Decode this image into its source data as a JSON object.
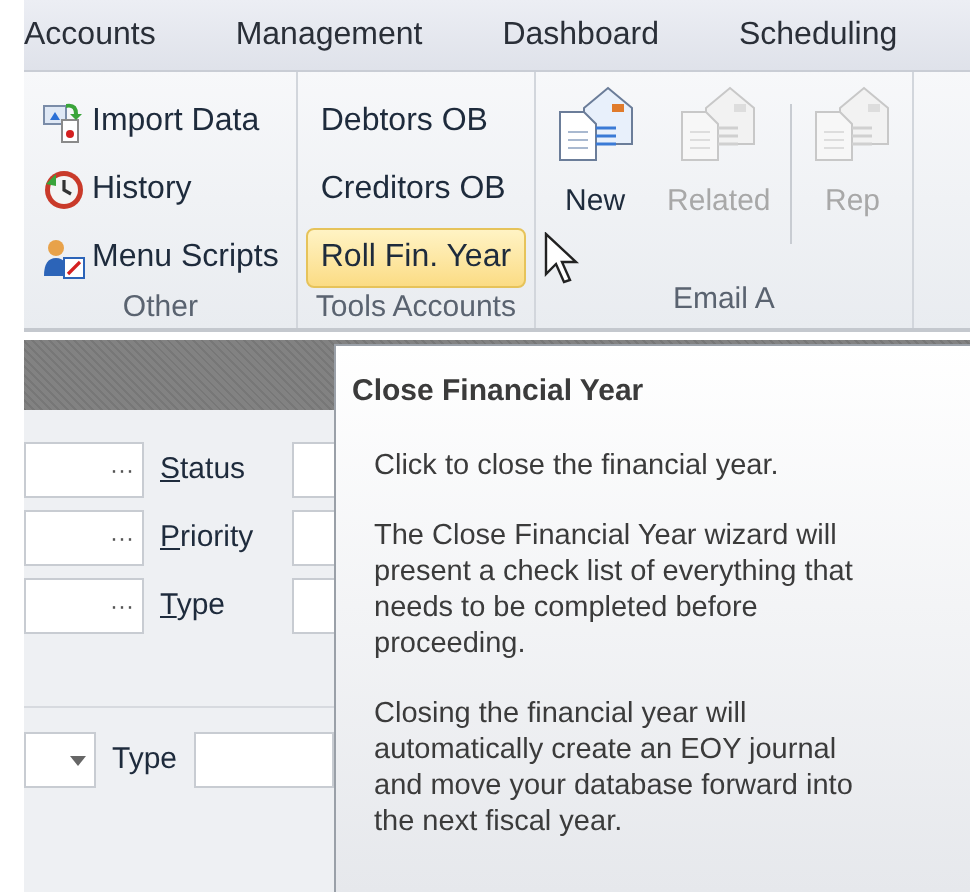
{
  "ribbon_tabs": [
    {
      "label": "Accounts",
      "selected": false
    },
    {
      "label": "Management",
      "selected": false
    },
    {
      "label": "Dashboard",
      "selected": false
    },
    {
      "label": "Scheduling",
      "selected": false
    }
  ],
  "groups": [
    {
      "title": "Other",
      "kind": "small",
      "items": [
        {
          "label": "Import Data",
          "highlighted": false,
          "disabled": false
        },
        {
          "label": "History",
          "highlighted": false,
          "disabled": false
        },
        {
          "label": "Menu Scripts",
          "highlighted": false,
          "disabled": false
        }
      ]
    },
    {
      "title": "Tools Accounts",
      "kind": "text",
      "items": [
        {
          "label": "Debtors OB",
          "highlighted": false,
          "disabled": false
        },
        {
          "label": "Creditors OB",
          "highlighted": false,
          "disabled": false
        },
        {
          "label": "Roll Fin. Year",
          "highlighted": true,
          "disabled": false
        }
      ]
    },
    {
      "title": "Email A",
      "kind": "large",
      "items": [
        {
          "label": "New",
          "highlighted": false,
          "disabled": false
        },
        {
          "label": "Related",
          "highlighted": false,
          "disabled": true
        },
        {
          "label": "Rep",
          "highlighted": false,
          "disabled": true
        }
      ]
    }
  ],
  "form_rows": [
    {
      "button": "···",
      "label": "Status",
      "accelerator": true
    },
    {
      "button": "···",
      "label": "Priority",
      "accelerator": true
    },
    {
      "button": "···",
      "label": "Type",
      "accelerator": true
    }
  ],
  "bottom_row": {
    "label": "Type"
  },
  "tooltip": {
    "title": "Close Financial Year",
    "paragraphs": [
      "Click to close the financial year.",
      "The Close Financial Year wizard will present a check list of everything that needs to be completed before proceeding.",
      "Closing the financial year will automatically create an EOY journal and move your database forward into the next fiscal year."
    ]
  }
}
